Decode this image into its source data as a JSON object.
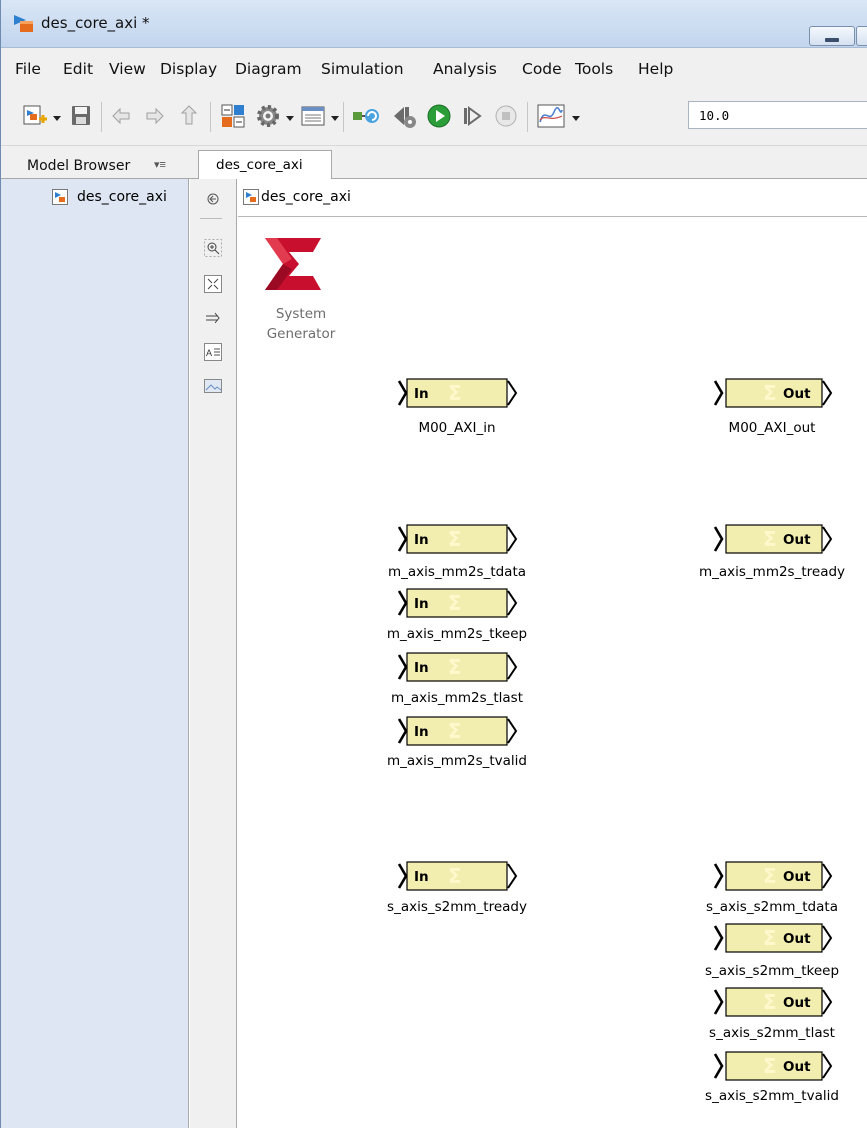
{
  "window": {
    "title": "des_core_axi *"
  },
  "menu": [
    "File",
    "Edit",
    "View",
    "Display",
    "Diagram",
    "Simulation",
    "Analysis",
    "Code",
    "Tools",
    "Help"
  ],
  "toolbar": {
    "stop_time": "10.0",
    "icons": [
      "new-model-icon",
      "save-icon",
      "back-icon",
      "forward-icon",
      "up-icon",
      "library-browser-icon",
      "settings-icon",
      "model-explorer-icon",
      "update-diagram-icon",
      "step-back-icon",
      "run-icon",
      "step-forward-icon",
      "stop-icon",
      "scope-icon"
    ]
  },
  "model_browser": {
    "label": "Model Browser",
    "menu_glyph": "▾≡",
    "items": [
      {
        "label": "des_core_axi"
      }
    ]
  },
  "tab": {
    "label": "des_core_axi"
  },
  "breadcrumb": {
    "label": "des_core_axi"
  },
  "palette": [
    "hide-browser-icon",
    "zoom-icon",
    "fit-view-icon",
    "arrow-icon",
    "annotation-icon",
    "image-icon"
  ],
  "logo": {
    "line1": "System",
    "line2": "Generator",
    "color": "#c8102e"
  },
  "block_style": {
    "fill": "#f2eeb0",
    "sigma_color": "#fff8cc"
  },
  "blocks": {
    "in_text": "In",
    "out_text": "Out",
    "inputs": [
      {
        "name": "M00_AXI_in"
      },
      {
        "name": "m_axis_mm2s_tdata"
      },
      {
        "name": "m_axis_mm2s_tkeep"
      },
      {
        "name": "m_axis_mm2s_tlast"
      },
      {
        "name": "m_axis_mm2s_tvalid"
      },
      {
        "name": "s_axis_s2mm_tready"
      }
    ],
    "outputs": [
      {
        "name": "M00_AXI_out"
      },
      {
        "name": "m_axis_mm2s_tready"
      },
      {
        "name": "s_axis_s2mm_tdata"
      },
      {
        "name": "s_axis_s2mm_tkeep"
      },
      {
        "name": "s_axis_s2mm_tlast"
      },
      {
        "name": "s_axis_s2mm_tvalid"
      }
    ]
  }
}
